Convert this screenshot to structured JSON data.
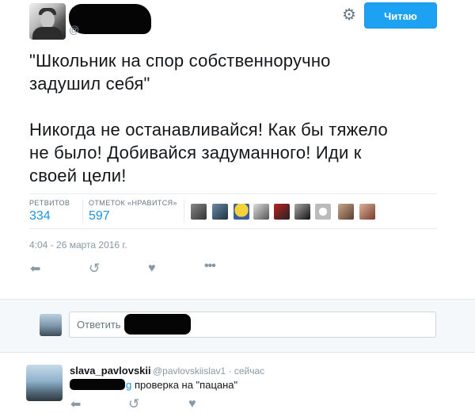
{
  "header": {
    "handle_prefix": "@",
    "follow_label": "Читаю",
    "settings_icon": "gear-icon"
  },
  "tweet": {
    "text": "\"Школьник на спор собственноручно\nзадушил себя\"\n\nНикогда не останавливайся! Как бы тяжело\nне было! Добивайся задуманного! Иди к\nсвоей цели!",
    "retweets_label": "РЕТВИТОВ",
    "retweets_count": "334",
    "likes_label": "ОТМЕТОК «НРАВИТСЯ»",
    "likes_count": "597",
    "timestamp": "4:04 - 26 марта 2016 г.",
    "actions": [
      "reply-icon",
      "retweet-icon",
      "like-icon",
      "more-icon"
    ]
  },
  "reply_box": {
    "placeholder": "Ответить"
  },
  "reply_tweet": {
    "name": "slava_pavlovskii",
    "handle_time": "@pavlovskiislav1 · сейчас",
    "mention_tail": "g",
    "text": "проверка на \"пацана\"",
    "actions": [
      "reply-icon",
      "retweet-icon",
      "like-icon"
    ]
  },
  "colors": {
    "accent": "#1da1f2",
    "link": "#1b95e0",
    "muted": "#8899a6"
  }
}
